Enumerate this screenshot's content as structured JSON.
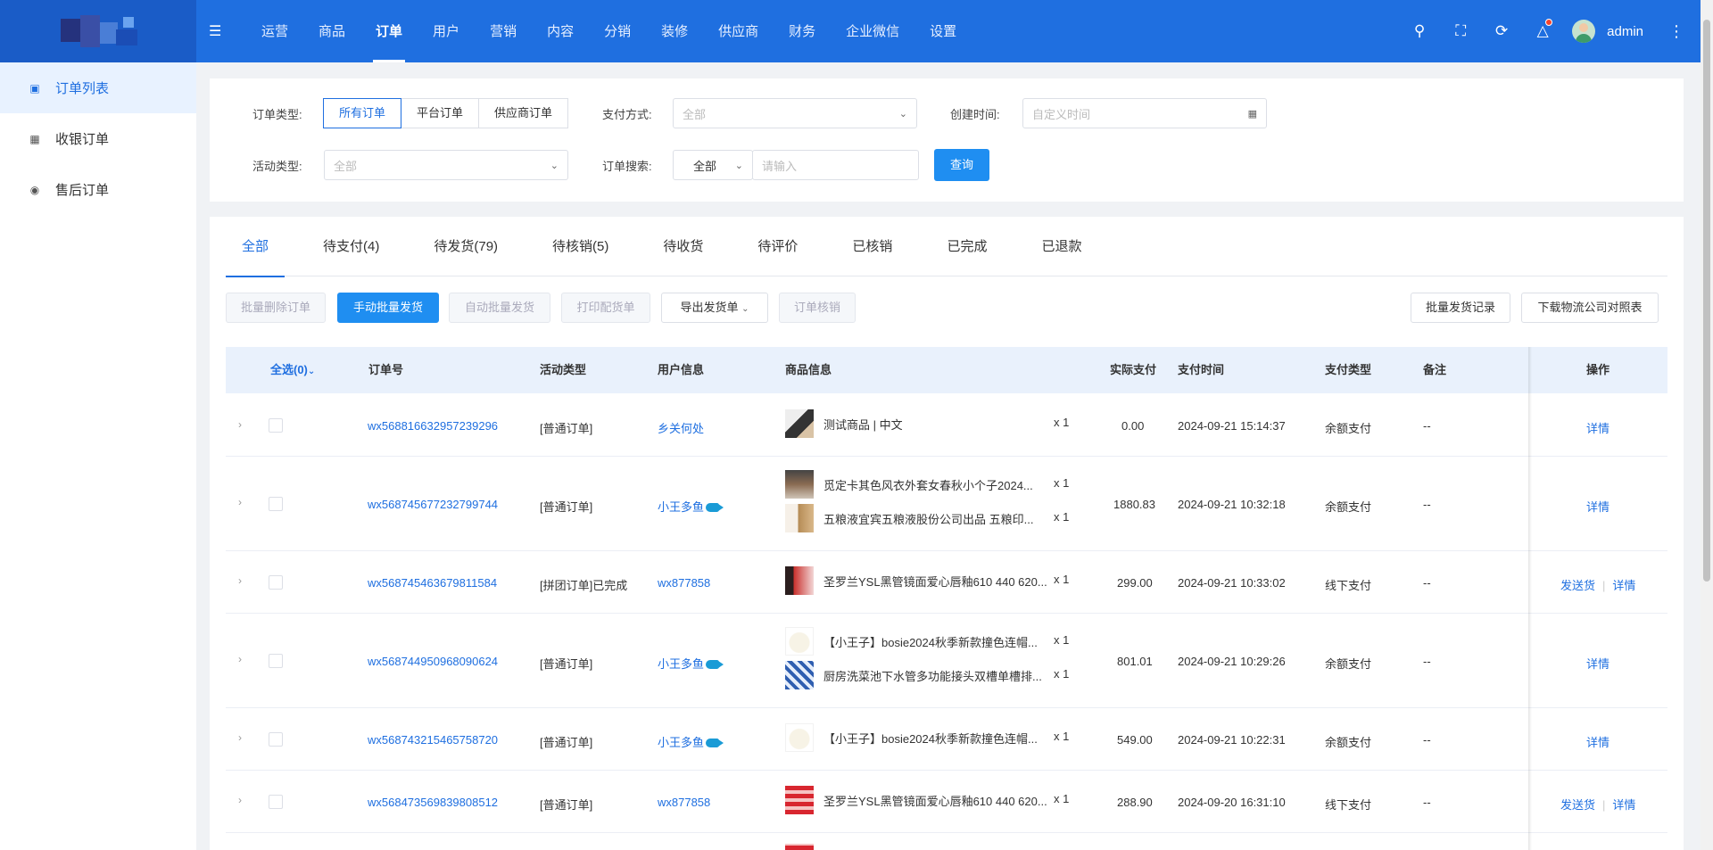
{
  "header": {
    "nav": [
      "运营",
      "商品",
      "订单",
      "用户",
      "营销",
      "内容",
      "分销",
      "装修",
      "供应商",
      "财务",
      "企业微信",
      "设置"
    ],
    "active_nav": "订单",
    "username": "admin"
  },
  "sidebar": {
    "items": [
      {
        "label": "订单列表",
        "icon": "cart-icon"
      },
      {
        "label": "收银订单",
        "icon": "cashier-icon"
      },
      {
        "label": "售后订单",
        "icon": "after-sale-icon"
      }
    ]
  },
  "filters": {
    "order_type_label": "订单类型:",
    "order_type_options": [
      "所有订单",
      "平台订单",
      "供应商订单"
    ],
    "pay_method_label": "支付方式:",
    "pay_method_value": "全部",
    "created_label": "创建时间:",
    "created_placeholder": "自定义时间",
    "activity_label": "活动类型:",
    "activity_value": "全部",
    "search_label": "订单搜索:",
    "search_scope": "全部",
    "search_placeholder": "请输入",
    "search_button": "查询"
  },
  "tabs": [
    "全部",
    "待支付(4)",
    "待发货(79)",
    "待核销(5)",
    "待收货",
    "待评价",
    "已核销",
    "已完成",
    "已退款"
  ],
  "toolbar": {
    "batch_delete": "批量删除订单",
    "manual_ship": "手动批量发货",
    "auto_ship": "自动批量发货",
    "print": "打印配货单",
    "export": "导出发货单",
    "verify": "订单核销",
    "ship_records": "批量发货记录",
    "download_logistics": "下载物流公司对照表"
  },
  "table": {
    "headers": {
      "select_all": "全选(0)",
      "order_no": "订单号",
      "activity": "活动类型",
      "user": "用户信息",
      "goods": "商品信息",
      "paid": "实际支付",
      "pay_time": "支付时间",
      "pay_type": "支付类型",
      "remark": "备注",
      "action": "操作"
    },
    "rows": [
      {
        "order_no": "wx568816632957239296",
        "activity": "[普通订单]",
        "user": "乡关何处",
        "goods": [
          {
            "name": "测试商品 | 中文",
            "qty": "x 1"
          }
        ],
        "paid": "0.00",
        "pay_time": "2024-09-21 15:14:37",
        "pay_type": "余额支付",
        "remark": "--",
        "actions": [
          "详情"
        ]
      },
      {
        "order_no": "wx568745677232799744",
        "activity": "[普通订单]",
        "user": "小王多鱼",
        "goods": [
          {
            "name": "觅定卡其色风衣外套女春秋小个子2024...",
            "qty": "x 1"
          },
          {
            "name": "五粮液宜宾五粮液股份公司出品 五粮印...",
            "qty": "x 1"
          }
        ],
        "paid": "1880.83",
        "pay_time": "2024-09-21 10:32:18",
        "pay_type": "余额支付",
        "remark": "--",
        "actions": [
          "详情"
        ]
      },
      {
        "order_no": "wx568745463679811584",
        "activity": "[拼团订单]已完成",
        "user": "wx877858",
        "goods": [
          {
            "name": "圣罗兰YSL黑管镜面爱心唇釉610 440 620...",
            "qty": "x 1"
          }
        ],
        "paid": "299.00",
        "pay_time": "2024-09-21 10:33:02",
        "pay_type": "线下支付",
        "remark": "--",
        "actions": [
          "发送货",
          "详情"
        ]
      },
      {
        "order_no": "wx568744950968090624",
        "activity": "[普通订单]",
        "user": "小王多鱼",
        "goods": [
          {
            "name": "【小王子】bosie2024秋季新款撞色连帽...",
            "qty": "x 1"
          },
          {
            "name": "厨房洗菜池下水管多功能接头双槽单槽排...",
            "qty": "x 1"
          }
        ],
        "paid": "801.01",
        "pay_time": "2024-09-21 10:29:26",
        "pay_type": "余额支付",
        "remark": "--",
        "actions": [
          "详情"
        ]
      },
      {
        "order_no": "wx568743215465758720",
        "activity": "[普通订单]",
        "user": "小王多鱼",
        "goods": [
          {
            "name": "【小王子】bosie2024秋季新款撞色连帽...",
            "qty": "x 1"
          }
        ],
        "paid": "549.00",
        "pay_time": "2024-09-21 10:22:31",
        "pay_type": "余额支付",
        "remark": "--",
        "actions": [
          "详情"
        ]
      },
      {
        "order_no": "wx568473569839808512",
        "activity": "[普通订单]",
        "user": "wx877858",
        "goods": [
          {
            "name": "圣罗兰YSL黑管镜面爱心唇釉610 440 620...",
            "qty": "x 1"
          }
        ],
        "paid": "288.90",
        "pay_time": "2024-09-20 16:31:10",
        "pay_type": "线下支付",
        "remark": "--",
        "actions": [
          "发送货",
          "详情"
        ]
      }
    ]
  }
}
